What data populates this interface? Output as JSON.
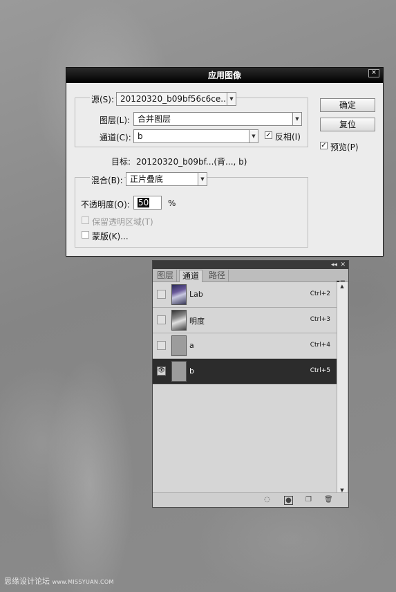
{
  "dialog": {
    "title": "应用图像",
    "close": "×",
    "source_label": "源(S):",
    "source_value": "20120320_b09bf56c6ce...",
    "layer_label": "图层(L):",
    "layer_value": "合并图层",
    "channel_label": "通道(C):",
    "channel_value": "b",
    "invert_label": "反相(I)",
    "invert_checked": true,
    "target_label": "目标:",
    "target_value": "20120320_b09bf...(背..., b)",
    "blend_label": "混合(B):",
    "blend_value": "正片叠底",
    "opacity_label": "不透明度(O):",
    "opacity_value": "50",
    "opacity_unit": "%",
    "preserve_label": "保留透明区域(T)",
    "mask_label": "蒙版(K)...",
    "ok_label": "确定",
    "reset_label": "复位",
    "preview_label": "预览(P)",
    "preview_checked": true
  },
  "panel": {
    "tabs": [
      "图层",
      "通道",
      "路径"
    ],
    "active_tab": 1,
    "channels": [
      {
        "name": "Lab",
        "shortcut": "Ctrl+2",
        "visible": false,
        "selected": false,
        "thumb": "color"
      },
      {
        "name": "明度",
        "shortcut": "Ctrl+3",
        "visible": false,
        "selected": false,
        "thumb": "gray"
      },
      {
        "name": "a",
        "shortcut": "Ctrl+4",
        "visible": false,
        "selected": false,
        "thumb": "flat"
      },
      {
        "name": "b",
        "shortcut": "Ctrl+5",
        "visible": true,
        "selected": true,
        "thumb": "flat"
      }
    ]
  },
  "watermark": {
    "text": "思缘设计论坛",
    "url": "www.MISSYUAN.COM"
  }
}
